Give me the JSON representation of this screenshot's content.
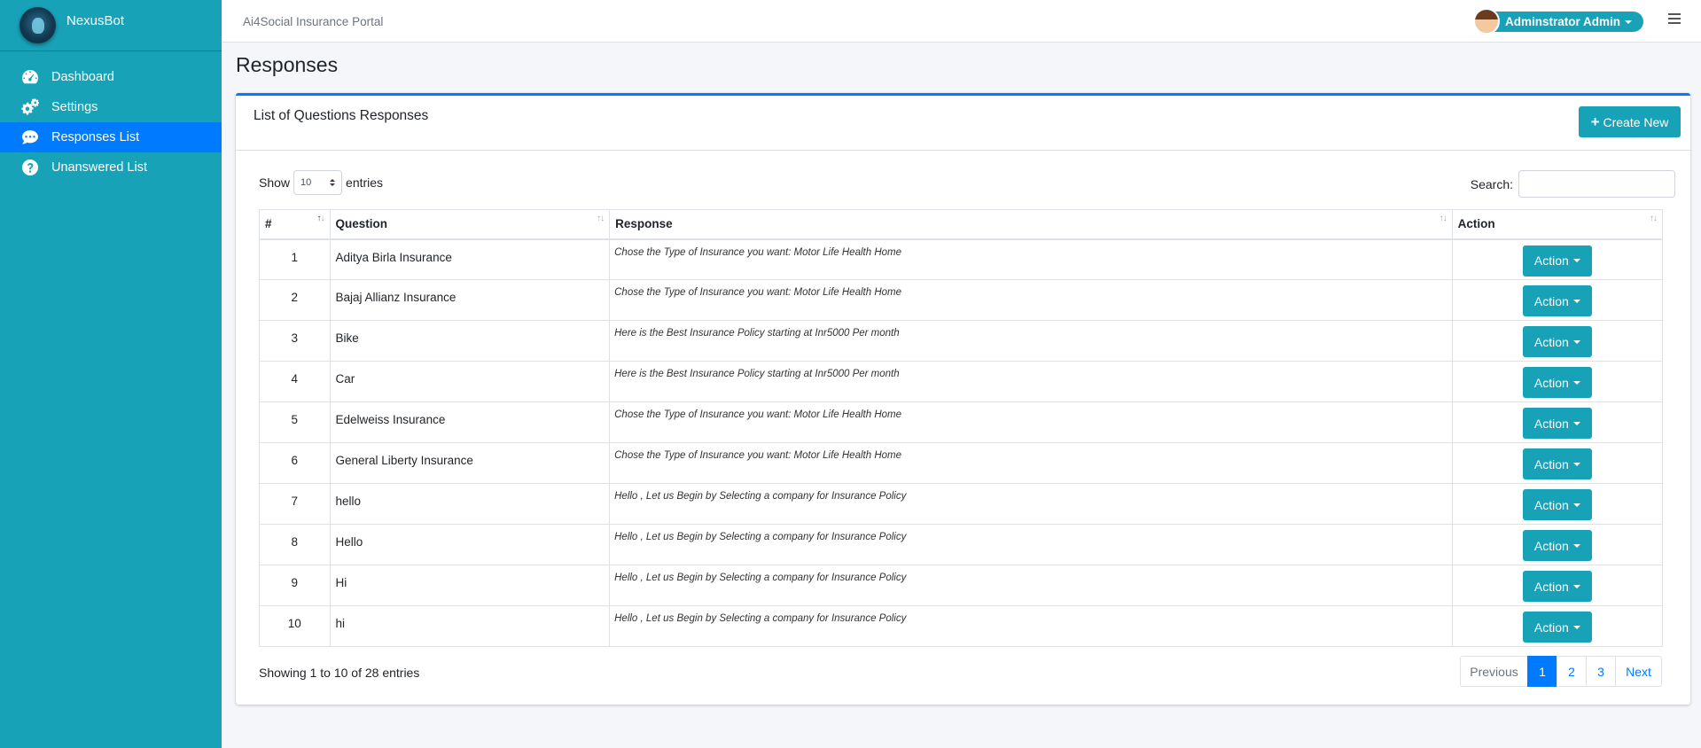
{
  "sidebar": {
    "brand": "NexusBot",
    "items": [
      {
        "label": "Dashboard",
        "icon": "dashboard-icon"
      },
      {
        "label": "Settings",
        "icon": "cogs-icon"
      },
      {
        "label": "Responses List",
        "icon": "comment-icon",
        "active": true
      },
      {
        "label": "Unanswered List",
        "icon": "question-icon"
      }
    ]
  },
  "topbar": {
    "title": "Ai4Social Insurance Portal",
    "user": "Adminstrator Admin"
  },
  "page": {
    "title": "Responses",
    "card_title": "List of Questions Responses",
    "create_label": "Create New"
  },
  "table": {
    "show_label": "Show",
    "entries_label": "entries",
    "page_length": "10",
    "search_label": "Search:",
    "headers": [
      "#",
      "Question",
      "Response",
      "Action"
    ],
    "action_label": "Action",
    "rows": [
      {
        "num": "1",
        "question": "Aditya Birla Insurance",
        "response": "Chose the Type of Insurance you want: Motor Life Health Home"
      },
      {
        "num": "2",
        "question": "Bajaj Allianz Insurance",
        "response": "Chose the Type of Insurance you want: Motor Life Health Home"
      },
      {
        "num": "3",
        "question": "Bike",
        "response": "Here is the Best Insurance Policy starting at Inr5000 Per month"
      },
      {
        "num": "4",
        "question": "Car",
        "response": "Here is the Best Insurance Policy starting at Inr5000 Per month"
      },
      {
        "num": "5",
        "question": "Edelweiss Insurance",
        "response": "Chose the Type of Insurance you want: Motor Life Health Home"
      },
      {
        "num": "6",
        "question": "General Liberty Insurance",
        "response": "Chose the Type of Insurance you want: Motor Life Health Home"
      },
      {
        "num": "7",
        "question": "hello",
        "response": "Hello , Let us Begin by Selecting a company for Insurance Policy"
      },
      {
        "num": "8",
        "question": "Hello",
        "response": "Hello , Let us Begin by Selecting a company for Insurance Policy"
      },
      {
        "num": "9",
        "question": "Hi",
        "response": "Hello , Let us Begin by Selecting a company for Insurance Policy"
      },
      {
        "num": "10",
        "question": "hi",
        "response": "Hello , Let us Begin by Selecting a company for Insurance Policy"
      }
    ],
    "info": "Showing 1 to 10 of 28 entries"
  },
  "pagination": {
    "previous": "Previous",
    "pages": [
      "1",
      "2",
      "3"
    ],
    "current": "1",
    "next": "Next"
  },
  "colors": {
    "sidebar": "#17a2b8",
    "active": "#007bff",
    "button": "#17a2b8"
  }
}
